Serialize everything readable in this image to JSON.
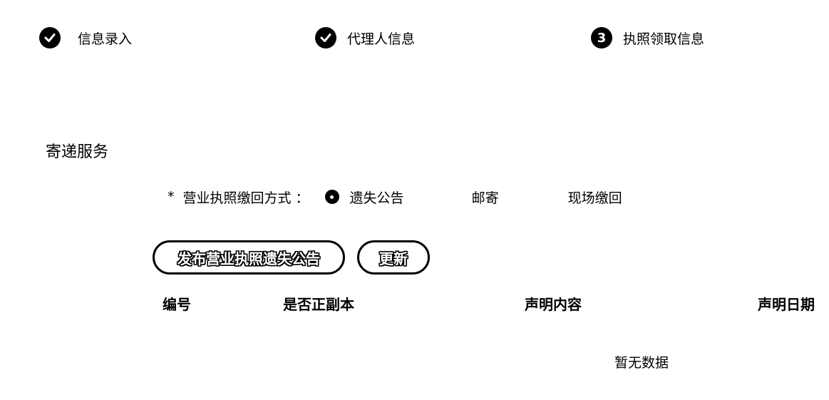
{
  "steps": [
    {
      "label": "信息录入",
      "status": "done",
      "icon": "check-circle-icon"
    },
    {
      "label": "代理人信息",
      "status": "done",
      "icon": "check-circle-icon"
    },
    {
      "label": "执照领取信息",
      "status": "current",
      "number": "3"
    }
  ],
  "section": {
    "title": "寄递服务"
  },
  "form": {
    "required_mark": "*",
    "label": "营业执照缴回方式 ：",
    "options": [
      "遗失公告",
      "邮寄",
      "现场缴回"
    ],
    "selected": "遗失公告"
  },
  "buttons": {
    "publish": "发布营业执照遗失公告",
    "refresh": "更新"
  },
  "table": {
    "columns": [
      "编号",
      "是否正副本",
      "声明内容",
      "声明日期"
    ],
    "rows": [],
    "empty_text": "暂无数据"
  }
}
